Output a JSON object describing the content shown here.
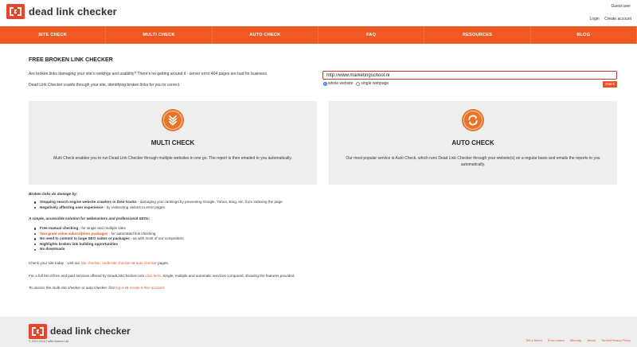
{
  "header": {
    "brand": "dead link checker",
    "guest": "Guest user",
    "login": "Login",
    "create_account": "Create account"
  },
  "nav": {
    "items": [
      "SITE CHECK",
      "MULTI CHECK",
      "AUTO CHECK",
      "FAQ",
      "RESOURCES",
      "BLOG"
    ]
  },
  "main": {
    "title": "FREE BROKEN LINK CHECKER",
    "intro1": "Are broken links damaging your site's rankings and usability? There's no getting around it - server error 404 pages are bad for business.",
    "intro2": "Dead Link Checker crawls through your site, identifying broken links for you to correct.",
    "url_value": "http://www.marketingschool.nl",
    "radio_whole": "whole website",
    "radio_single": "single webpage",
    "check_label": "check"
  },
  "cards": {
    "multi": {
      "icon": "chevron-down-icon",
      "title": "MULTI CHECK",
      "desc": "Multi Check enables you to run Dead Link Checker through multiple websites in one go. The report is then emailed to you automatically."
    },
    "auto": {
      "icon": "refresh-icon",
      "title": "AUTO CHECK",
      "desc": "Our most popular service is Auto Check, which runs Dead Link Checker through your website(s) on a regular basis and emails the reports to you automatically."
    }
  },
  "damage": {
    "heading": "Broken links do damage by:",
    "items": [
      {
        "bold": "Stopping search engine website crawlers in their tracks",
        "rest": " - damaging your rankings by preventing Google, Yahoo, Bing, etc. from indexing the page"
      },
      {
        "bold": "Negatively affecting user experience",
        "rest": " - by redirecting visitors to error pages."
      }
    ]
  },
  "solution": {
    "heading": "A simple, accessible solution for webmasters and professional SEOs:",
    "items": [
      {
        "bold": "Free manual checking",
        "rest": " - for single and multiple sites",
        "style": "b"
      },
      {
        "bold": "Two great value subscription packages",
        "rest": " - for automated link checking",
        "style": "orange"
      },
      {
        "bold": "No need to commit to large SEO suites or packages",
        "rest": " - as with most of our competitors",
        "style": "b"
      },
      {
        "bold": "Highlights broken link building opportunities",
        "rest": "",
        "style": "b"
      },
      {
        "bold": "No downloads",
        "rest": "",
        "style": "b"
      }
    ]
  },
  "para1": {
    "pre": "Check your site today - visit our ",
    "link1": "site checker",
    "mid1": ", ",
    "link2": "multi-site checker",
    "mid2": " or ",
    "link3": "auto checker",
    "post": " pages."
  },
  "para2": {
    "pre": "For a full list of free and paid services offered by DeadLinkChecker.com ",
    "link": "click here",
    "post": ". Single, multiple and automatic services compared, showing the features provided."
  },
  "para3": {
    "pre": "To access the multi-site checker or auto checker, first ",
    "link1": "log in",
    "mid": " or ",
    "link2": "create a free account",
    "post": "."
  },
  "footer": {
    "brand": "dead link checker",
    "copyright": "© 2013-2016 Traffic Names Ltd",
    "links": [
      "Tell a friend",
      "Error codes",
      "Sitemap",
      "About",
      "Terms/Privacy Policy"
    ]
  },
  "colors": {
    "accent": "#f15a22",
    "card_bg": "#eeeeee",
    "icon_circle": "#e8742a"
  }
}
